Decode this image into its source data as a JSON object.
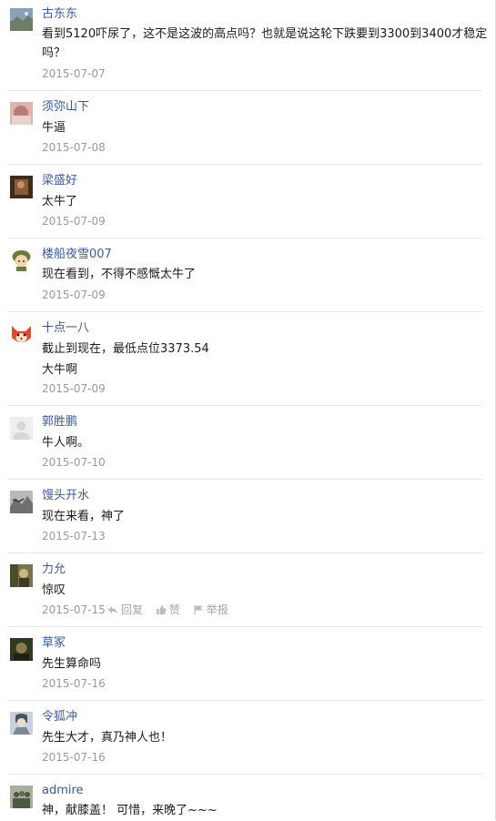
{
  "comments": [
    {
      "name": "古东东",
      "lines": [
        "看到5120吓尿了，这不是这波的高点吗？也就是说这轮下跌要到3300到3400才稳定",
        "吗？"
      ],
      "date": "2015-07-07",
      "avatar_icon": "landscape-avatar-icon"
    },
    {
      "name": "须弥山下",
      "lines": [
        "牛逼"
      ],
      "date": "2015-07-08",
      "avatar_icon": "photo-avatar-icon"
    },
    {
      "name": "梁盛好",
      "lines": [
        "太牛了"
      ],
      "date": "2015-07-09",
      "avatar_icon": "dark-photo-avatar-icon"
    },
    {
      "name": "楼船夜雪007",
      "lines": [
        "现在看到，不得不感慨太牛了"
      ],
      "date": "2015-07-09",
      "avatar_icon": "soldier-cartoon-avatar-icon"
    },
    {
      "name": "十点一八",
      "lines": [
        "截止到现在，最低点位3373.54",
        "大牛啊"
      ],
      "date": "2015-07-09",
      "avatar_icon": "red-fox-cartoon-avatar-icon"
    },
    {
      "name": "郭胜鹏",
      "lines": [
        "牛人啊。"
      ],
      "date": "2015-07-10",
      "avatar_icon": "default-avatar-icon"
    },
    {
      "name": "馒头开水",
      "lines": [
        "现在来看，神了"
      ],
      "date": "2015-07-13",
      "avatar_icon": "grey-photo-avatar-icon"
    },
    {
      "name": "力允",
      "lines": [
        "惊叹"
      ],
      "date": "2015-07-15",
      "avatar_icon": "olive-photo-avatar-icon",
      "actions": {
        "reply": "回复",
        "like": "赞",
        "report": "举报"
      }
    },
    {
      "name": "草冢",
      "lines": [
        "先生算命吗"
      ],
      "date": "2015-07-16",
      "avatar_icon": "dark-green-photo-avatar-icon"
    },
    {
      "name": "令狐冲",
      "lines": [
        "先生大才，真乃神人也！"
      ],
      "date": "2015-07-16",
      "avatar_icon": "character-avatar-icon"
    },
    {
      "name": "admire",
      "lines": [
        "神，献膝盖！ 可惜，来晚了~~~"
      ],
      "date": "",
      "avatar_icon": "group-photo-avatar-icon"
    }
  ],
  "colors": {
    "name": "#3b5998",
    "date": "#9a9a9a",
    "divider": "#e6e6e6"
  }
}
